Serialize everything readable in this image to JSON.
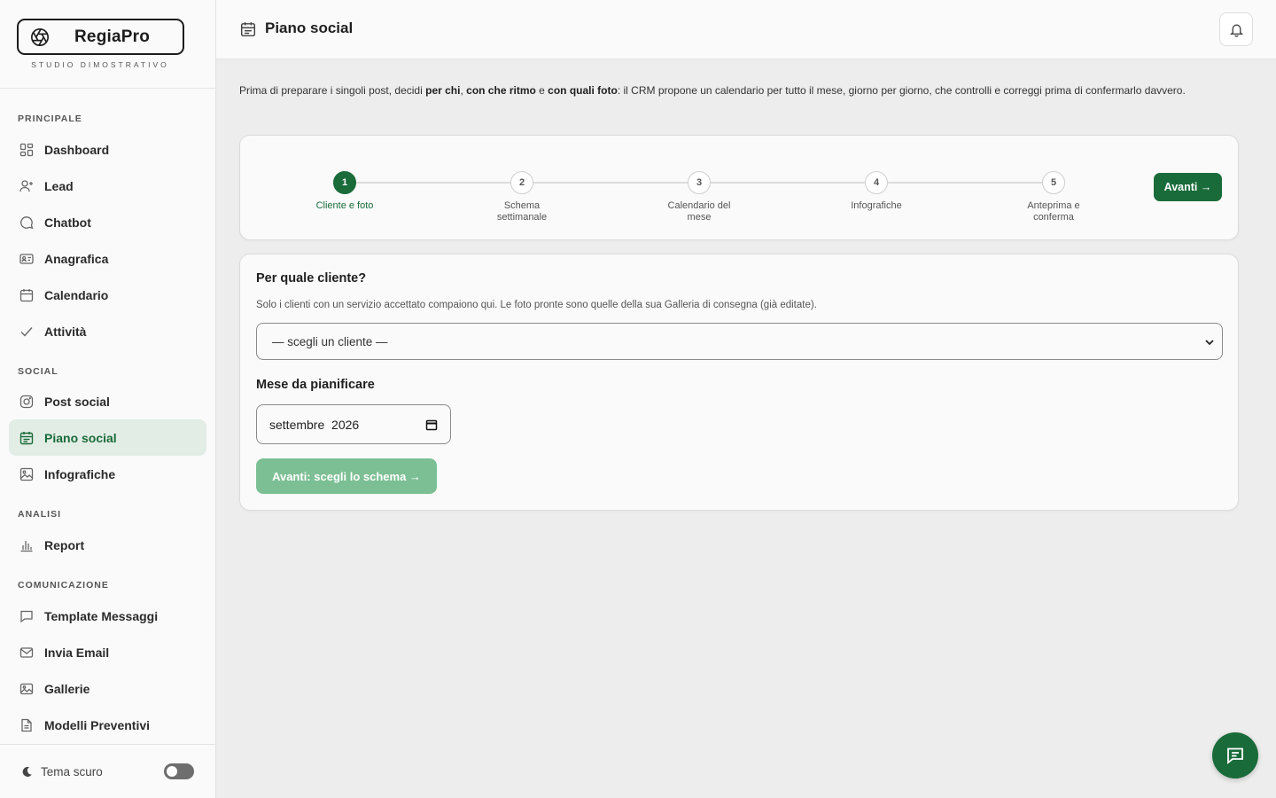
{
  "brand": {
    "name": "RegiaPro",
    "subtitle": "STUDIO DIMOSTRATIVO"
  },
  "sidebar": {
    "sections": [
      {
        "title": "PRINCIPALE"
      },
      {
        "title": "SOCIAL"
      },
      {
        "title": "ANALISI"
      },
      {
        "title": "COMUNICAZIONE"
      }
    ],
    "items": [
      {
        "label": "Dashboard",
        "icon": "dashboard-icon"
      },
      {
        "label": "Lead",
        "icon": "user-plus-icon"
      },
      {
        "label": "Chatbot",
        "icon": "chat-bubble-icon"
      },
      {
        "label": "Anagrafica",
        "icon": "id-card-icon"
      },
      {
        "label": "Calendario",
        "icon": "calendar-icon"
      },
      {
        "label": "Attività",
        "icon": "check-icon"
      },
      {
        "label": "Post social",
        "icon": "instagram-icon"
      },
      {
        "label": "Piano social",
        "icon": "calendar-plan-icon",
        "active": true
      },
      {
        "label": "Infografiche",
        "icon": "image-icon"
      },
      {
        "label": "Report",
        "icon": "bar-chart-icon"
      },
      {
        "label": "Template Messaggi",
        "icon": "message-square-icon"
      },
      {
        "label": "Invia Email",
        "icon": "mail-icon"
      },
      {
        "label": "Gallerie",
        "icon": "gallery-icon"
      },
      {
        "label": "Modelli Preventivi",
        "icon": "document-icon"
      }
    ],
    "theme": {
      "label": "Tema scuro",
      "enabled": false
    }
  },
  "header": {
    "title": "Piano social"
  },
  "intro": {
    "part1": "Prima di preparare i singoli post, decidi ",
    "bold1": "per chi",
    "part2": ", ",
    "bold2": "con che ritmo",
    "part3": " e ",
    "bold3": "con quali foto",
    "part4": ": il CRM propone un calendario per tutto il mese, giorno per giorno, che controlli e correggi prima di confermarlo davvero."
  },
  "stepper": {
    "steps": [
      {
        "number": "1",
        "label": "Cliente e foto",
        "active": true
      },
      {
        "number": "2",
        "label": "Schema settimanale"
      },
      {
        "number": "3",
        "label": "Calendario del mese"
      },
      {
        "number": "4",
        "label": "Infografiche"
      },
      {
        "number": "5",
        "label": "Anteprima e conferma"
      }
    ],
    "next_label": "Avanti →"
  },
  "form": {
    "client_title": "Per quale cliente?",
    "client_help": "Solo i clienti con un servizio accettato compaiono qui. Le foto pronte sono quelle della sua Galleria di consegna (già editate).",
    "client_select_value": "— scegli un cliente —",
    "month_title": "Mese da pianificare",
    "month_value": "settembre  2026",
    "submit_label": "Avanti: scegli lo schema →"
  },
  "colors": {
    "accent": "#1a6b3a",
    "accent_soft": "#e2ede5",
    "disabled_button": "#7dbf94"
  }
}
